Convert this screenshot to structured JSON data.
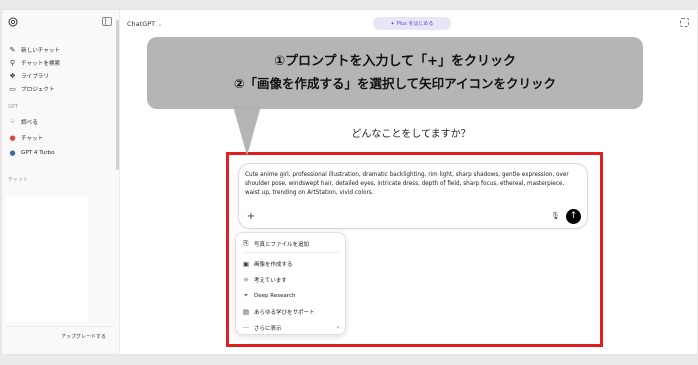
{
  "sidebar": {
    "items": [
      {
        "label": "新しいチャット",
        "icon": "edit-icon"
      },
      {
        "label": "チャットを検索",
        "icon": "search-icon"
      },
      {
        "label": "ライブラリ",
        "icon": "library-icon"
      },
      {
        "label": "プロジェクト",
        "icon": "folder-icon"
      }
    ],
    "gpt_section": "GPT",
    "gpts": [
      {
        "label": "調べる",
        "icon": "grid-icon"
      },
      {
        "label": "チャット",
        "icon": "gpt-avatar-icon"
      },
      {
        "label": "GPT 4 Turbo",
        "icon": "gpt4-avatar-icon"
      }
    ],
    "chat_section": "チャット",
    "upgrade_label": "アップグレードする"
  },
  "header": {
    "model": "ChatGPT",
    "plus_label": "Plus をはじめる"
  },
  "callout": {
    "line1": "①プロンプトを入力して「+」をクリック",
    "line2": "②「画像を作成する」を選択して矢印アイコンをクリック"
  },
  "greeting": "どんなことをしてますか？",
  "composer": {
    "text": "Cute anime girl, professional illustration, dramatic backlighting, rim light, sharp shadows, gentle expression, over shoulder pose, windswept hair, detailed eyes, intricate dress, depth of field, sharp focus, ethereal, masterpiece, waist up, trending on ArtStation, vivid colors."
  },
  "menu": {
    "items": [
      {
        "label": "写真とファイルを追加",
        "icon": "paperclip-icon"
      },
      {
        "label": "画像を作成する",
        "icon": "image-icon"
      },
      {
        "label": "考えています",
        "icon": "lightbulb-icon"
      },
      {
        "label": "Deep Research",
        "icon": "telescope-icon"
      },
      {
        "label": "あらゆる学びをサポート",
        "icon": "book-icon"
      },
      {
        "label": "さらに表示",
        "icon": "more-icon"
      }
    ]
  },
  "colors": {
    "highlight": "#e02020",
    "plus_accent": "#5d4bd1"
  }
}
